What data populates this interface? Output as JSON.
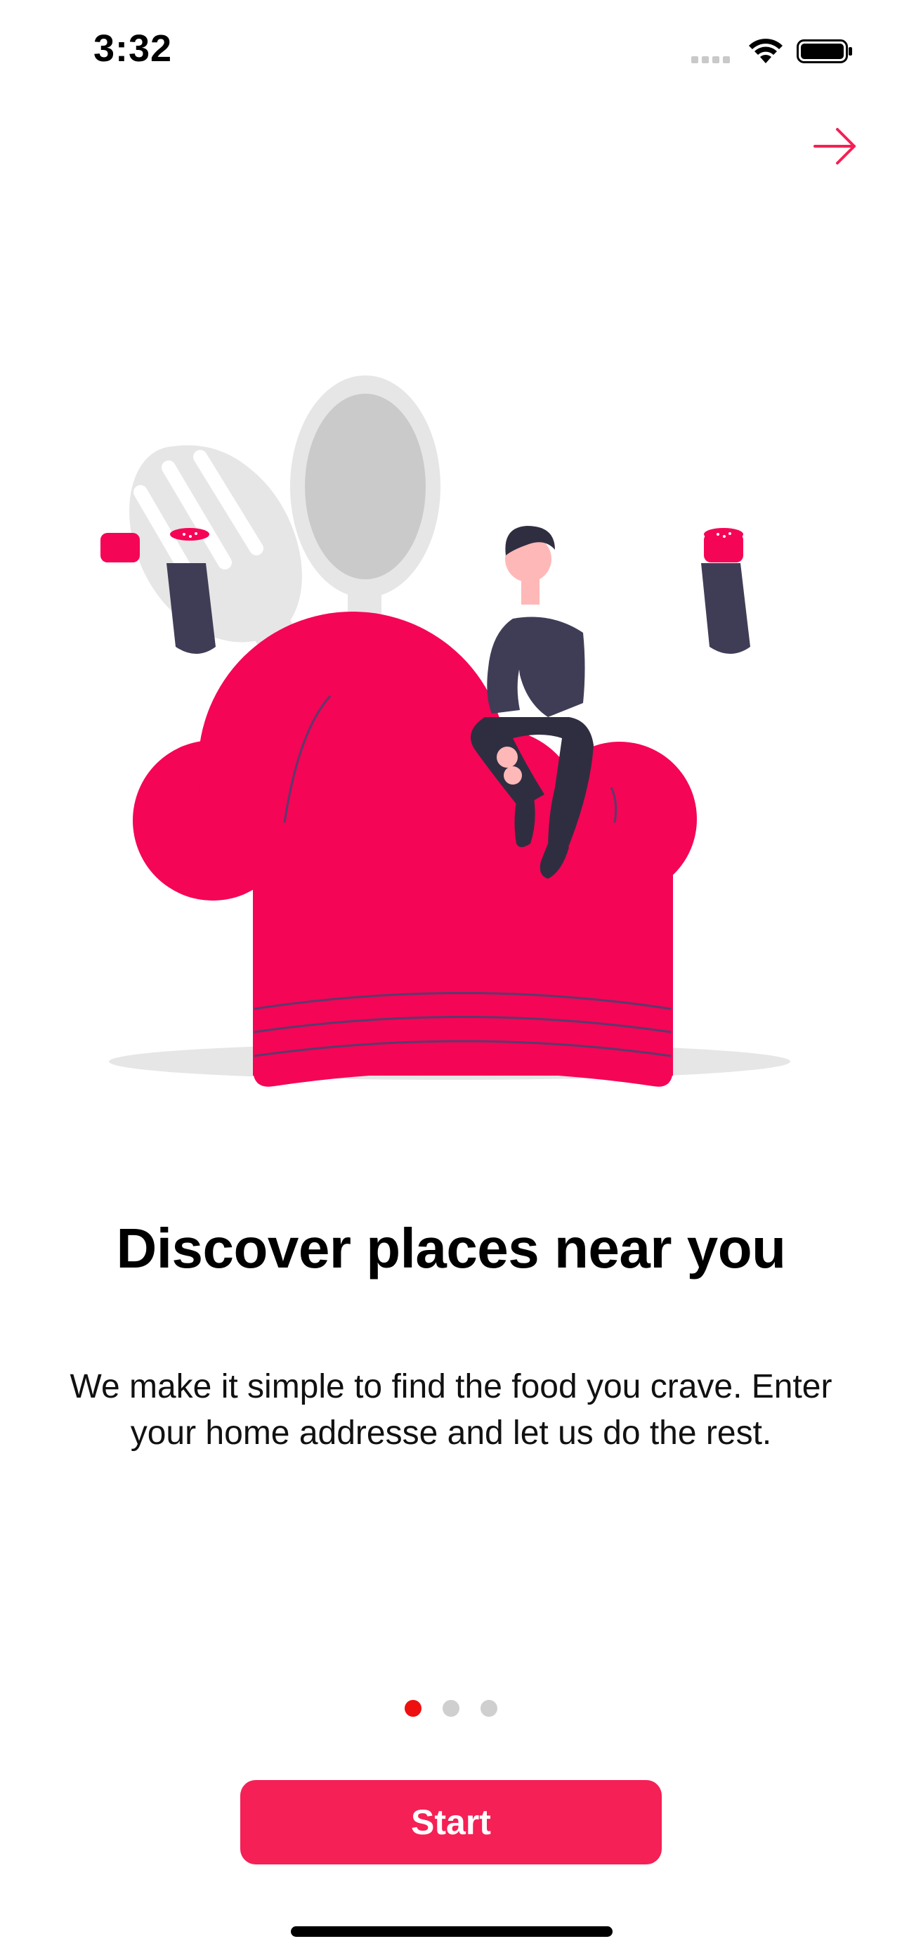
{
  "status_bar": {
    "time": "3:32",
    "icons": [
      "cellular-signal-icon",
      "wifi-icon",
      "battery-icon"
    ]
  },
  "header": {
    "skip_icon": "arrow-right-icon"
  },
  "onboarding": {
    "illustration": "chef-hat-with-person-illustration",
    "title": "Discover places near you",
    "description": "We make it simple to find the food you crave. Enter your  home addresse and let us do the rest."
  },
  "pager": {
    "current_page": 1,
    "total_pages": 3
  },
  "start_button": {
    "label": "Start"
  },
  "colors": {
    "accent": "#f52055",
    "active_dot": "#ee1010",
    "inactive_dot": "#cfcfcf",
    "figure_dark": "#3f3d56"
  }
}
